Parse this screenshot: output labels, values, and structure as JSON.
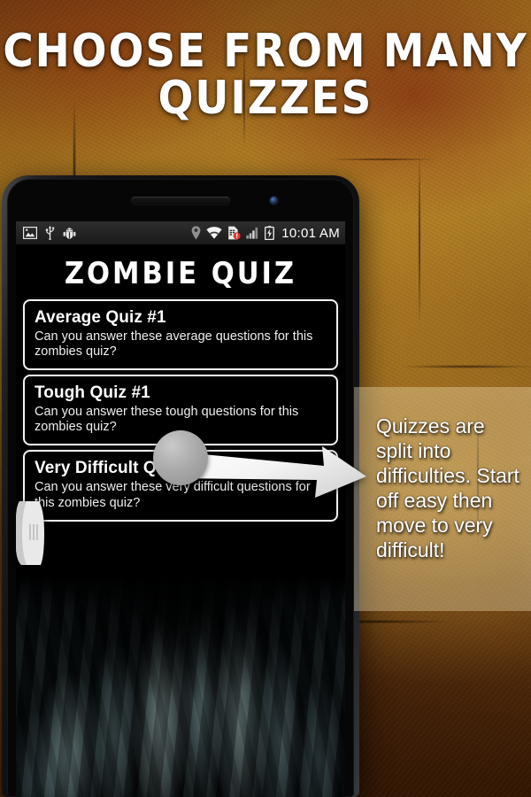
{
  "promo": {
    "headline_line1": "CHOOSE FROM MANY",
    "headline_line2": "QUIZZES",
    "caption": "Quizzes are split into difficulties. Start off easy then move to very difficult!"
  },
  "colors": {
    "headline": "#ffffff",
    "card_border": "#f2f2f2",
    "card_background": "#000000",
    "background_amber": "#b8882a",
    "background_dark": "#331703",
    "alert_badge": "#e8342a"
  },
  "phone": {
    "statusbar": {
      "left_icons": [
        "image-icon",
        "usb-icon",
        "android-bug-icon"
      ],
      "right_icons": [
        "location-pin-icon",
        "wifi-icon",
        "sim-card-alert-icon",
        "signal-bars-icon",
        "battery-charging-icon"
      ],
      "clock": "10:01 AM"
    },
    "app": {
      "title": "ZOMBIE QUIZ",
      "quizzes": [
        {
          "title": "Average Quiz #1",
          "description": "Can you answer these average questions for this zombies quiz?"
        },
        {
          "title": "Tough Quiz #1",
          "description": "Can you answer these tough questions for this zombies quiz?"
        },
        {
          "title": "Very Difficult Quiz #1",
          "description": "Can you answer these very difficult questions for this zombies quiz?"
        }
      ]
    }
  }
}
